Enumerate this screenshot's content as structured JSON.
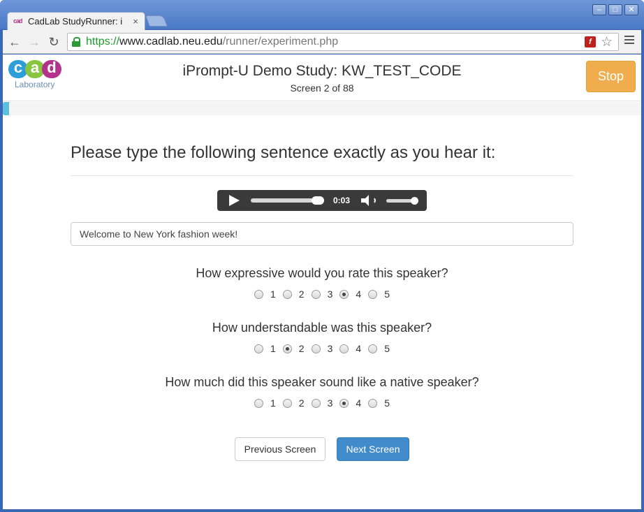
{
  "browser": {
    "tab_title": "CadLab StudyRunner: i",
    "tab_favicon": "cad-logo-icon",
    "url_scheme": "https://",
    "url_host": "www.cadlab.neu.edu",
    "url_path": "/runner/experiment.php",
    "window_controls": [
      "minimize",
      "maximize",
      "close"
    ]
  },
  "header": {
    "logo_letters": [
      "c",
      "a",
      "d"
    ],
    "logo_subtitle": "Laboratory",
    "study_title": "iPrompt-U Demo Study: KW_TEST_CODE",
    "screen_count": "Screen 2 of 88",
    "stop_label": "Stop"
  },
  "progress": {
    "value_fraction": 0.01,
    "color": "#5bc0de"
  },
  "main": {
    "prompt": "Please type the following sentence exactly as you hear it:",
    "audio": {
      "time": "0:03",
      "seek_fraction": 1.0,
      "volume_fraction": 1.0
    },
    "answer_value": "Welcome to New York fashion week!",
    "questions": [
      {
        "text": "How expressive would you rate this speaker?",
        "options": [
          "1",
          "2",
          "3",
          "4",
          "5"
        ],
        "selected": "4"
      },
      {
        "text": "How understandable was this speaker?",
        "options": [
          "1",
          "2",
          "3",
          "4",
          "5"
        ],
        "selected": "2"
      },
      {
        "text": "How much did this speaker sound like a native speaker?",
        "options": [
          "1",
          "2",
          "3",
          "4",
          "5"
        ],
        "selected": "4"
      }
    ],
    "prev_label": "Previous Screen",
    "next_label": "Next Screen"
  },
  "colors": {
    "stop": "#efad4d",
    "next": "#428bca",
    "chrome": "#4a78c6"
  }
}
